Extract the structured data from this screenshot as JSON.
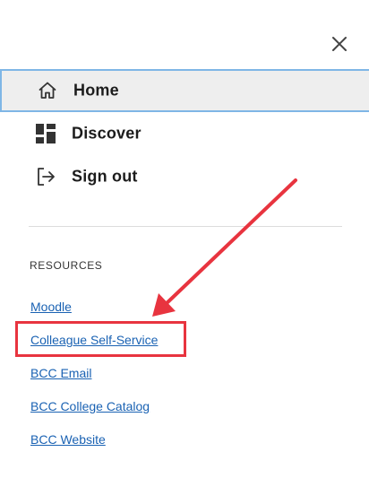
{
  "menu": {
    "close_icon": "close-icon",
    "items": [
      {
        "label": "Home",
        "icon": "home-icon",
        "active": true
      },
      {
        "label": "Discover",
        "icon": "dashboard-icon",
        "active": false
      },
      {
        "label": "Sign out",
        "icon": "sign-out-icon",
        "active": false
      }
    ]
  },
  "resources": {
    "title": "RESOURCES",
    "links": [
      "Moodle",
      "Colleague Self-Service",
      "BCC Email",
      "BCC College Catalog",
      "BCC Website"
    ]
  },
  "annotation": {
    "color": "#e8343f"
  }
}
